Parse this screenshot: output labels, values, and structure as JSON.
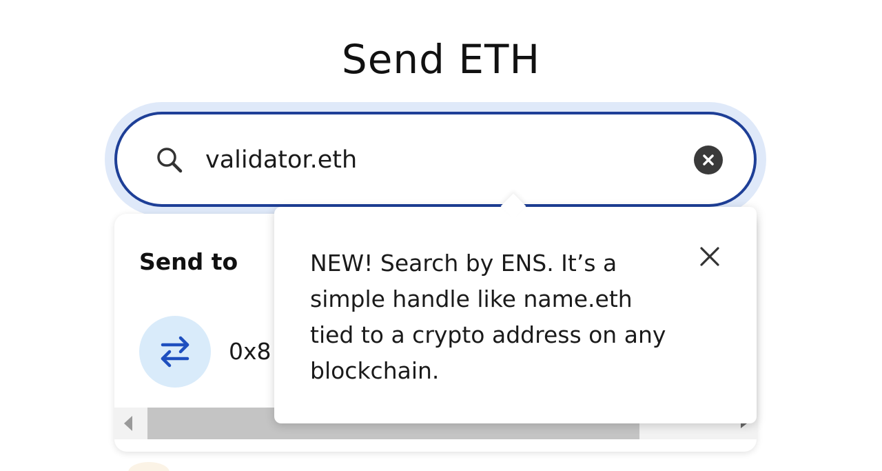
{
  "header": {
    "title": "Send ETH"
  },
  "search": {
    "value": "validator.eth",
    "icon": "search-icon",
    "clear_icon": "clear-icon"
  },
  "results": {
    "section_label": "Send to",
    "items": [
      {
        "icon": "transfer-arrows-icon",
        "address": "0x8"
      }
    ]
  },
  "tooltip": {
    "text": "NEW! Search by ENS. It’s a simple handle like name.eth tied to a crypto address on any blockchain.",
    "close_icon": "close-icon"
  },
  "colors": {
    "accent": "#1e3f97",
    "focus_halo": "#dfe9f9",
    "avatar_bg": "#d9ebfa",
    "transfer_icon": "#1e4fbf"
  }
}
